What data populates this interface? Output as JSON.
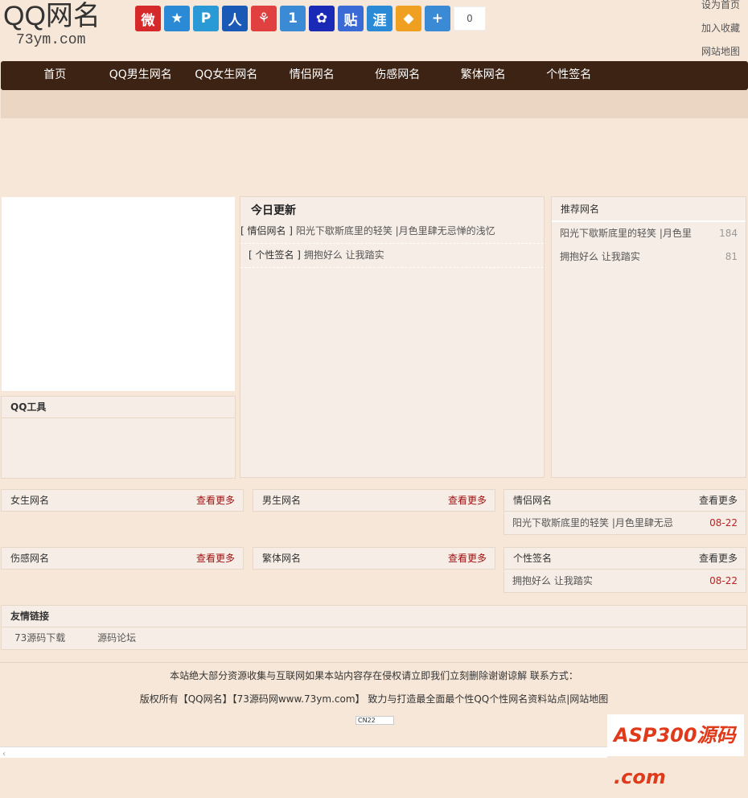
{
  "logo": {
    "title": "QQ网名",
    "domain": "73ym.com"
  },
  "share": {
    "icons": [
      {
        "name": "weibo-icon",
        "glyph": "微",
        "color": "#d62a2a"
      },
      {
        "name": "qzone-icon",
        "glyph": "★",
        "color": "#2a8ad6"
      },
      {
        "name": "tencent-weibo-icon",
        "glyph": "P",
        "color": "#2a9ad6"
      },
      {
        "name": "renren-icon",
        "glyph": "人",
        "color": "#1a5ab6"
      },
      {
        "name": "kaixin-icon",
        "glyph": "⚘",
        "color": "#e04040"
      },
      {
        "name": "baidu-one-icon",
        "glyph": "1",
        "color": "#3a8ad6"
      },
      {
        "name": "baidu-paw-icon",
        "glyph": "✿",
        "color": "#1a2ab6"
      },
      {
        "name": "tieba-icon",
        "glyph": "贴",
        "color": "#3a6ad6"
      },
      {
        "name": "hui-icon",
        "glyph": "涯",
        "color": "#2a8ad6"
      },
      {
        "name": "youdao-icon",
        "glyph": "◆",
        "color": "#f0a020"
      },
      {
        "name": "more-share-icon",
        "glyph": "+",
        "color": "#3a8ad6"
      }
    ],
    "count": "0"
  },
  "top_links": [
    "设为首页",
    "加入收藏",
    "网站地图"
  ],
  "nav": [
    "首页",
    "QQ男生网名",
    "QQ女生网名",
    "情侣网名",
    "伤感网名",
    "繁体网名",
    "个性签名"
  ],
  "tools": {
    "title": "QQ工具"
  },
  "today": {
    "title": "今日更新",
    "items": [
      {
        "tag": "[ 情侣网名 ]",
        "text": "阳光下歇斯底里的轻笑 |月色里肆无忌惮的浅忆"
      },
      {
        "tag": "[ 个性签名 ]",
        "text": "拥抱好么 让我踏实"
      }
    ]
  },
  "recommend": {
    "title": "推荐网名",
    "items": [
      {
        "text": "阳光下歇斯底里的轻笑 |月色里",
        "count": "184"
      },
      {
        "text": "拥抱好么 让我踏实",
        "count": "81"
      }
    ]
  },
  "more_label": "查看更多",
  "categories": [
    {
      "title": "女生网名",
      "items": []
    },
    {
      "title": "男生网名",
      "items": []
    },
    {
      "title": "情侣网名",
      "items": [
        {
          "text": "阳光下歇斯底里的轻笑 |月色里肆无忌",
          "date": "08-22"
        }
      ]
    },
    {
      "title": "伤感网名",
      "items": []
    },
    {
      "title": "繁体网名",
      "items": []
    },
    {
      "title": "个性签名",
      "items": [
        {
          "text": "拥抱好么 让我踏实",
          "date": "08-22"
        }
      ]
    }
  ],
  "friend_links": {
    "title": "友情链接",
    "items": [
      "73源码下载",
      "源码论坛"
    ]
  },
  "footer": {
    "line1": "本站绝大部分资源收集与互联网如果本站内容存在侵权请立即我们立刻删除谢谢谅解  联系方式：",
    "line2": "版权所有【QQ网名】【73源码网www.73ym.com】 致力与打造最全面最个性QQ个性网名资料站点|网站地图",
    "badge": "CN22",
    "watermark": "ASP300源码 .com"
  }
}
